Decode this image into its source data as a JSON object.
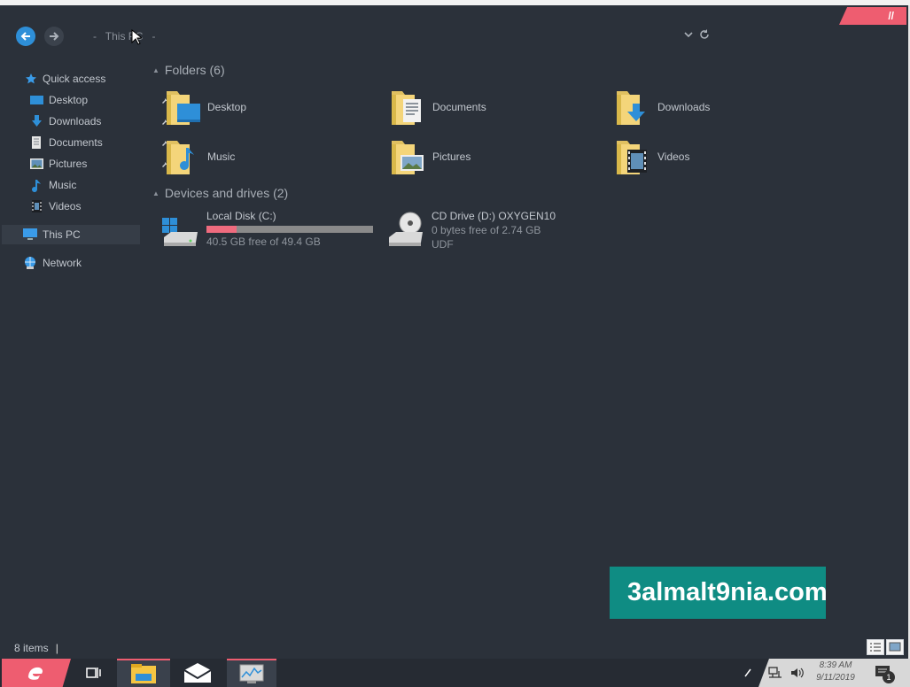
{
  "window": {
    "corner_mark": "//"
  },
  "breadcrumb": {
    "sep": "-",
    "location": "This PC",
    "tail": "-"
  },
  "sidebar": {
    "quick_access": "Quick access",
    "items": [
      {
        "label": "Desktop",
        "pinned": true
      },
      {
        "label": "Downloads",
        "pinned": true
      },
      {
        "label": "Documents",
        "pinned": true
      },
      {
        "label": "Pictures",
        "pinned": true
      },
      {
        "label": "Music",
        "pinned": false
      },
      {
        "label": "Videos",
        "pinned": false
      }
    ],
    "this_pc": "This PC",
    "network": "Network"
  },
  "main": {
    "folders_header": "Folders (6)",
    "folders": [
      {
        "name": "Desktop",
        "icon": "desktop-folder-icon"
      },
      {
        "name": "Documents",
        "icon": "documents-folder-icon"
      },
      {
        "name": "Downloads",
        "icon": "downloads-folder-icon"
      },
      {
        "name": "Music",
        "icon": "music-folder-icon"
      },
      {
        "name": "Pictures",
        "icon": "pictures-folder-icon"
      },
      {
        "name": "Videos",
        "icon": "videos-folder-icon"
      }
    ],
    "drives_header": "Devices and drives (2)",
    "drives": [
      {
        "name": "Local Disk (C:)",
        "free": "40.5 GB free of 49.4 GB",
        "used_fraction": 0.18
      },
      {
        "name": "CD Drive (D:) OXYGEN10",
        "free": "0 bytes free of 2.74 GB",
        "fs": "UDF"
      }
    ]
  },
  "watermark": "3almalt9nia.com",
  "status": {
    "items": "8 items",
    "caret": "|"
  },
  "taskbar": {
    "time": "8:39 AM",
    "date": "9/11/2019",
    "notifications": "1"
  },
  "colors": {
    "accent": "#ee5d70",
    "background": "#2b313a",
    "watermark_bg": "#0f8c83",
    "nav_blue": "#2e8fd8"
  }
}
